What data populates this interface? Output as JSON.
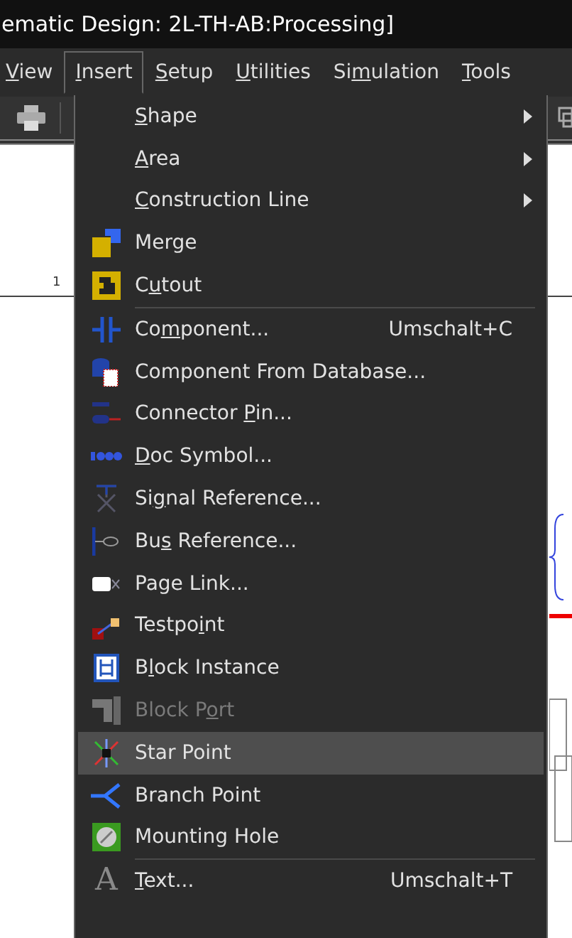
{
  "window": {
    "title": "ematic Design: 2L-TH-AB:Processing]"
  },
  "menu_bar": [
    {
      "label": {
        "key": "V",
        "after": "iew"
      },
      "selected": false
    },
    {
      "label": {
        "key": "I",
        "after": "nsert"
      },
      "selected": true
    },
    {
      "label": {
        "key": "S",
        "after": "etup"
      },
      "selected": false
    },
    {
      "label": {
        "key": "U",
        "after": "tilities"
      },
      "selected": false
    },
    {
      "label": {
        "before": "Si",
        "key": "m",
        "after": "ulation"
      },
      "selected": false
    },
    {
      "label": {
        "key": "T",
        "after": "ools"
      },
      "selected": false
    }
  ],
  "canvas": {
    "ruler_label": "1"
  },
  "insert_menu": [
    {
      "kind": "item",
      "label": {
        "key": "S",
        "after": "hape"
      },
      "submenu": true,
      "disabled": false,
      "selected": false
    },
    {
      "kind": "item",
      "label": {
        "key": "A",
        "after": "rea"
      },
      "submenu": true,
      "disabled": false,
      "selected": false
    },
    {
      "kind": "item",
      "label": {
        "key": "C",
        "after": "onstruction Line"
      },
      "submenu": true,
      "disabled": false,
      "selected": false
    },
    {
      "kind": "item",
      "label": {
        "before": "Merge"
      },
      "submenu": false,
      "disabled": false,
      "selected": false
    },
    {
      "kind": "item",
      "label": {
        "before": "C",
        "key": "u",
        "after": "tout"
      },
      "submenu": false,
      "disabled": false,
      "selected": false
    },
    {
      "kind": "separator"
    },
    {
      "kind": "item",
      "label": {
        "before": "Co",
        "key": "m",
        "after": "ponent..."
      },
      "shortcut": "Umschalt+C",
      "submenu": false,
      "disabled": false,
      "selected": false
    },
    {
      "kind": "item",
      "label": {
        "before": "Component From Database..."
      },
      "submenu": false,
      "disabled": false,
      "selected": false
    },
    {
      "kind": "item",
      "label": {
        "before": "Connector ",
        "key": "P",
        "after": "in..."
      },
      "submenu": false,
      "disabled": false,
      "selected": false
    },
    {
      "kind": "item",
      "label": {
        "key": "D",
        "after": "oc Symbol..."
      },
      "submenu": false,
      "disabled": false,
      "selected": false
    },
    {
      "kind": "item",
      "label": {
        "before": "Si",
        "key": "g",
        "after": "nal Reference..."
      },
      "submenu": false,
      "disabled": false,
      "selected": false
    },
    {
      "kind": "item",
      "label": {
        "before": "Bu",
        "key": "s",
        "after": " Reference..."
      },
      "submenu": false,
      "disabled": false,
      "selected": false
    },
    {
      "kind": "item",
      "label": {
        "before": "Page Link..."
      },
      "submenu": false,
      "disabled": false,
      "selected": false
    },
    {
      "kind": "item",
      "label": {
        "before": "Testpo",
        "key": "i",
        "after": "nt"
      },
      "submenu": false,
      "disabled": false,
      "selected": false
    },
    {
      "kind": "item",
      "label": {
        "before": "B",
        "key": "l",
        "after": "ock Instance"
      },
      "submenu": false,
      "disabled": false,
      "selected": false
    },
    {
      "kind": "item",
      "label": {
        "before": "Block P",
        "key": "o",
        "after": "rt"
      },
      "submenu": false,
      "disabled": true,
      "selected": false
    },
    {
      "kind": "item",
      "label": {
        "before": "Star Point"
      },
      "submenu": false,
      "disabled": false,
      "selected": true
    },
    {
      "kind": "item",
      "label": {
        "before": "Branch Point"
      },
      "submenu": false,
      "disabled": false,
      "selected": false
    },
    {
      "kind": "item",
      "label": {
        "before": "Mounting Hole"
      },
      "submenu": false,
      "disabled": false,
      "selected": false
    },
    {
      "kind": "separator"
    },
    {
      "kind": "item",
      "icon_text": "A",
      "label": {
        "key": "T",
        "after": "ext..."
      },
      "shortcut": "Umschalt+T",
      "submenu": false,
      "disabled": false,
      "selected": false
    }
  ]
}
